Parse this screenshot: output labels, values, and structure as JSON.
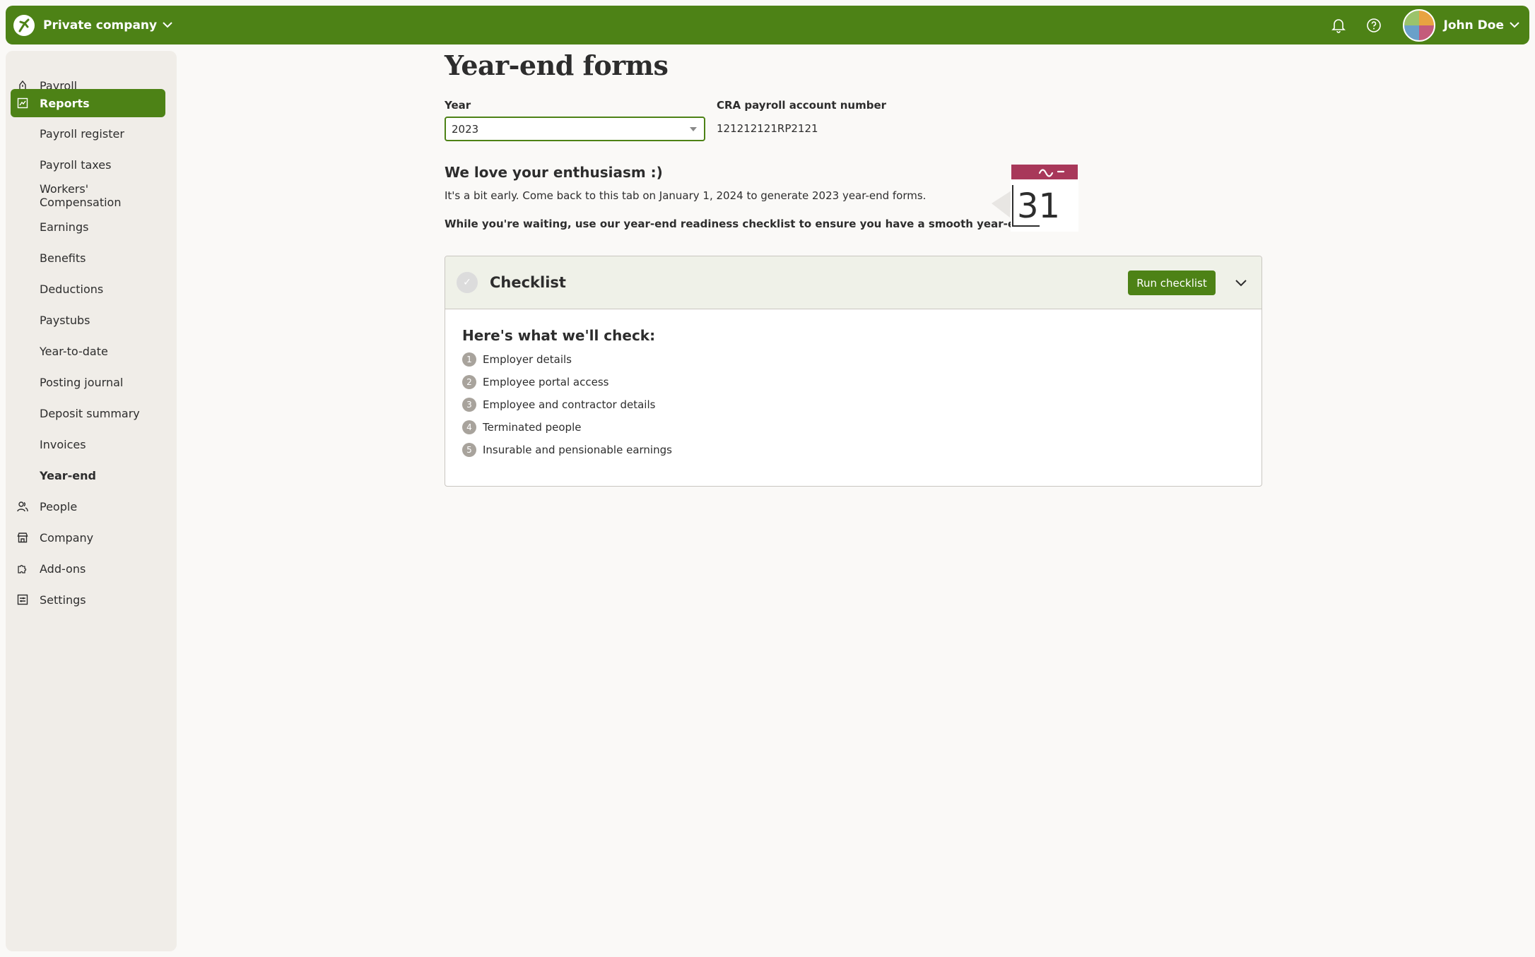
{
  "header": {
    "company": "Private company",
    "user": "John Doe",
    "icons": [
      "bell-icon",
      "help-icon"
    ]
  },
  "sidebar": {
    "items": [
      {
        "label": "Payroll",
        "icon": "payroll-icon"
      },
      {
        "label": "Reports",
        "icon": "reports-icon",
        "active": true
      },
      {
        "label": "Payroll register"
      },
      {
        "label": "Payroll taxes"
      },
      {
        "label": "Workers' Compensation"
      },
      {
        "label": "Earnings"
      },
      {
        "label": "Benefits"
      },
      {
        "label": "Deductions"
      },
      {
        "label": "Paystubs"
      },
      {
        "label": "Year-to-date"
      },
      {
        "label": "Posting journal"
      },
      {
        "label": "Deposit summary"
      },
      {
        "label": "Invoices"
      },
      {
        "label": "Year-end",
        "current": true
      },
      {
        "label": "People",
        "icon": "people-icon"
      },
      {
        "label": "Company",
        "icon": "company-icon"
      },
      {
        "label": "Add-ons",
        "icon": "add-ons-icon"
      },
      {
        "label": "Settings",
        "icon": "settings-icon"
      }
    ]
  },
  "main": {
    "title": "Year-end forms",
    "year_label": "Year",
    "year_value": "2023",
    "cra_label": "CRA payroll account number",
    "cra_value": "121212121RP2121",
    "heading": "We love your enthusiasm :)",
    "para1": "It's a bit early. Come back to this tab on January 1, 2024 to generate 2023 year-end forms.",
    "para2": "While you're waiting, use our year-end readiness checklist to ensure you have a smooth year-end review:",
    "calendar_day": "31"
  },
  "checklist": {
    "title": "Checklist",
    "run_label": "Run checklist",
    "subtitle": "Here's what we'll check:",
    "items": [
      {
        "num": "1",
        "label": "Employer details"
      },
      {
        "num": "2",
        "label": "Employee portal access"
      },
      {
        "num": "3",
        "label": "Employee and contractor details"
      },
      {
        "num": "4",
        "label": "Terminated people"
      },
      {
        "num": "5",
        "label": "Insurable and pensionable earnings"
      }
    ]
  },
  "colors": {
    "brand": "#4d8216",
    "sidebar_bg": "#f0ede8",
    "checklist_header_bg": "#eff1e8",
    "calendar_accent": "#a8385a"
  }
}
